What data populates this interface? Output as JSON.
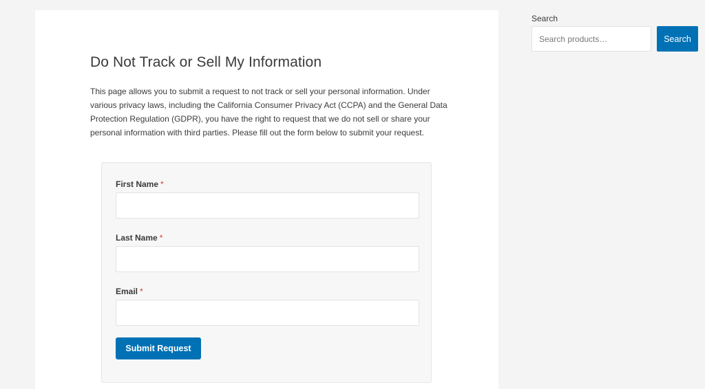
{
  "sidebar": {
    "search_label": "Search",
    "search_placeholder": "Search products…",
    "search_value": "",
    "search_button_label": "Search"
  },
  "main": {
    "title": "Do Not Track or Sell My Information",
    "intro": "This page allows you to submit a request to not track or sell your personal information. Under various privacy laws, including the California Consumer Privacy Act (CCPA) and the General Data Protection Regulation (GDPR), you have the right to request that we do not sell or share your personal information with third parties. Please fill out the form below to submit your request."
  },
  "form": {
    "first_name_label": "First Name",
    "first_name_value": "",
    "last_name_label": "Last Name",
    "last_name_value": "",
    "email_label": "Email",
    "email_value": "",
    "required_mark": "*",
    "submit_label": "Submit Request"
  },
  "colors": {
    "accent": "#0071b5",
    "required": "#d63638",
    "page_background": "#f4f4f4",
    "card_background": "#ffffff",
    "form_background": "#f7f7f7"
  }
}
